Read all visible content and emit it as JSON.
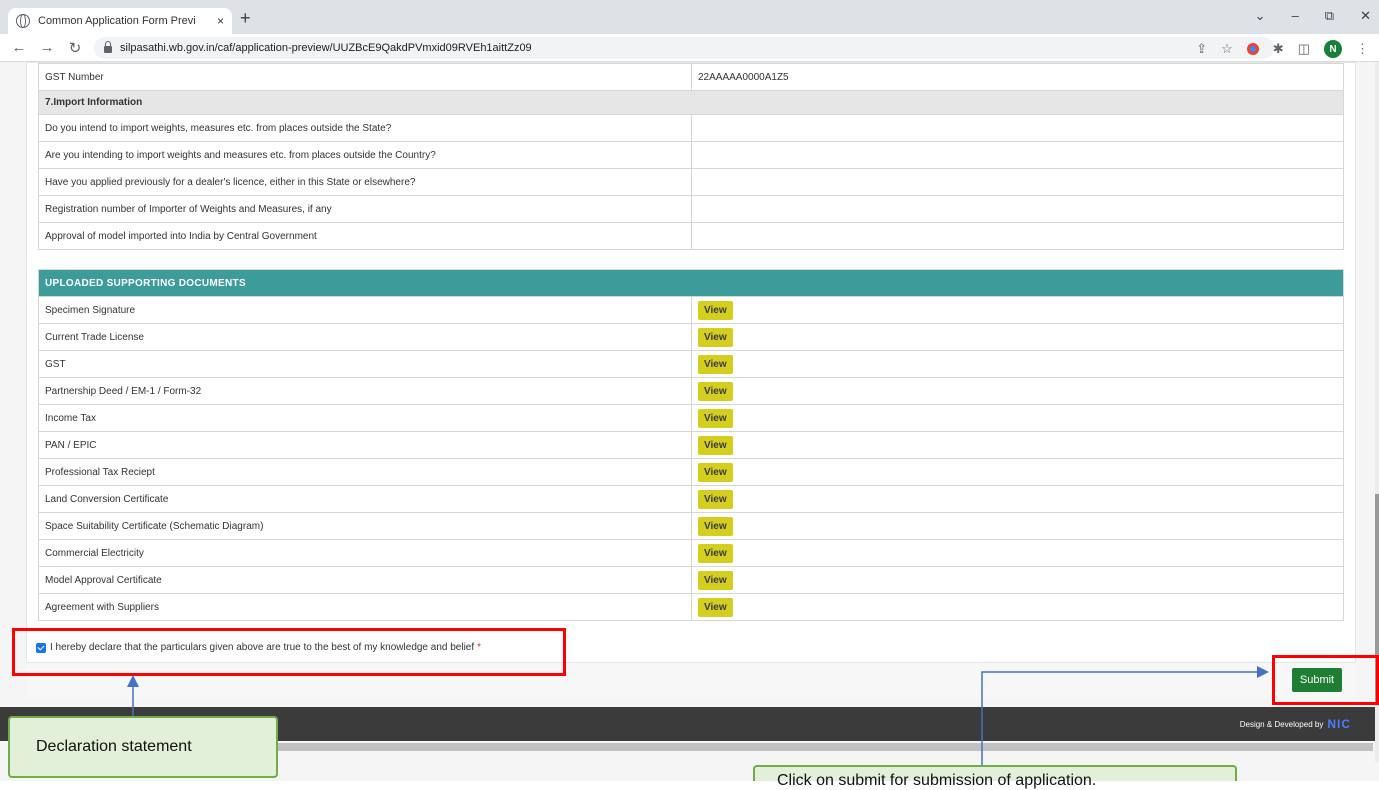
{
  "browser": {
    "tab_title": "Common Application Form Previ",
    "tab_close": "×",
    "new_tab": "+",
    "url": "silpasathi.wb.gov.in/caf/application-preview/UUZBcE9QakdPVmxid09RVEh1aittZz09",
    "avatar_letter": "N"
  },
  "gst_row": {
    "label": "GST Number",
    "value": "22AAAAA0000A1Z5"
  },
  "import_section": {
    "title": "7.Import Information",
    "rows": [
      {
        "label": "Do you intend to import weights, measures etc. from places outside the State?",
        "value": ""
      },
      {
        "label": "Are you intending to import weights and measures etc. from places outside the Country?",
        "value": ""
      },
      {
        "label": "Have you applied previously for a dealer's licence, either in this State or elsewhere?",
        "value": ""
      },
      {
        "label": "Registration number of Importer of Weights and Measures, if any",
        "value": ""
      },
      {
        "label": "Approval of model imported into India by Central Government",
        "value": ""
      }
    ]
  },
  "documents": {
    "title": "UPLOADED SUPPORTING DOCUMENTS",
    "view_label": "View",
    "items": [
      "Specimen Signature",
      "Current Trade License",
      "GST",
      "Partnership Deed / EM-1 / Form-32",
      "Income Tax",
      "PAN / EPIC",
      "Professional Tax Reciept",
      "Land Conversion Certificate",
      "Space Suitability Certificate (Schematic Diagram)",
      "Commercial Electricity",
      "Model Approval Certificate",
      "Agreement with Suppliers"
    ]
  },
  "declaration": {
    "text": "I hereby declare that the particulars given above are true to the best of my knowledge and belief",
    "required_mark": "*",
    "checked": true
  },
  "submit_label": "Submit",
  "footer": {
    "text": "Design & Developed by",
    "logo": "NIC"
  },
  "annotations": {
    "declaration_callout": "Declaration statement",
    "submit_callout": "Click on submit for submission of application."
  },
  "colors": {
    "section_header": "#3d9c9a",
    "view_button": "#d4cf1e",
    "submit_button": "#1e7e34",
    "annotation_border": "#ff0000",
    "callout_bg": "#e2efd9",
    "callout_border": "#70ad47"
  }
}
